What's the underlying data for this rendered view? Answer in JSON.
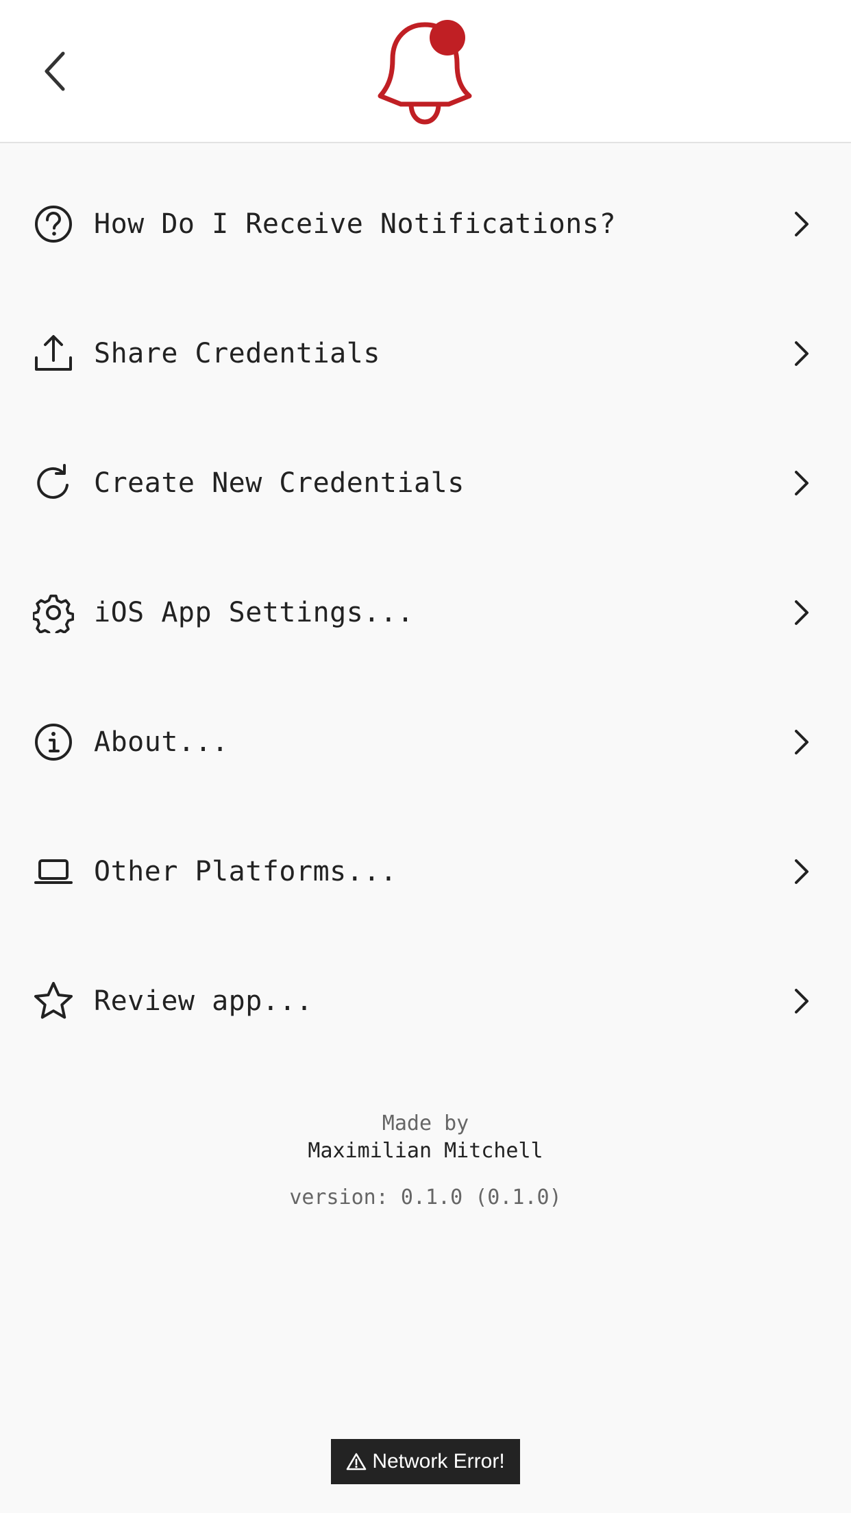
{
  "header": {
    "back_icon": "chevron-left-icon",
    "logo_icon": "notification-bell-icon",
    "accent_color": "#c01f24"
  },
  "menu": {
    "items": [
      {
        "label": "How Do I Receive Notifications?",
        "icon": "help-circle-icon"
      },
      {
        "label": "Share Credentials",
        "icon": "upload-icon"
      },
      {
        "label": "Create New Credentials",
        "icon": "refresh-icon"
      },
      {
        "label": "iOS App Settings...",
        "icon": "gear-icon"
      },
      {
        "label": "About...",
        "icon": "info-icon"
      },
      {
        "label": "Other Platforms...",
        "icon": "laptop-icon"
      },
      {
        "label": "Review app...",
        "icon": "star-icon"
      }
    ]
  },
  "footer": {
    "made_by": "Made by",
    "author": "Maximilian Mitchell",
    "version": "version: 0.1.0 (0.1.0)"
  },
  "toast": {
    "icon": "warning-icon",
    "message": "Network Error!"
  }
}
